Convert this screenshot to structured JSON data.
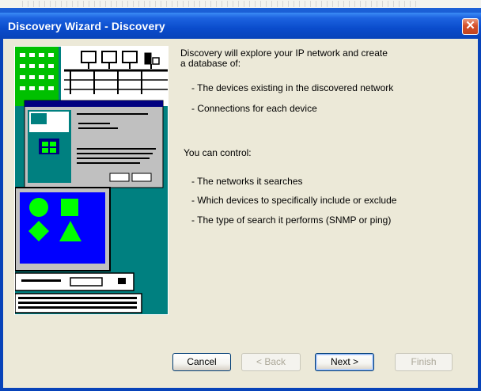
{
  "window": {
    "title": "Discovery Wizard - Discovery",
    "close_glyph": "✕"
  },
  "content": {
    "intro_line1": "Discovery will explore your IP network and create",
    "intro_line2": "a database of:",
    "bullets1": [
      "- The devices existing in the discovered network",
      "- Connections for each device"
    ],
    "control_heading": "You can control:",
    "bullets2": [
      "- The networks it searches",
      "- Which devices to specifically include or exclude",
      "- The type of search it performs (SNMP or ping)"
    ]
  },
  "buttons": {
    "cancel": "Cancel",
    "back": "< Back",
    "next": "Next >",
    "finish": "Finish"
  },
  "colors": {
    "titlebar": "#0a4ccc",
    "dialog_bg": "#ece9d8",
    "illustration_bg": "#008080",
    "illustration_shapes": "#00ff00"
  },
  "icons": [
    "close-icon",
    "network-computers-icon",
    "wizard-screenshot-icon",
    "monitor-shapes-icon"
  ]
}
